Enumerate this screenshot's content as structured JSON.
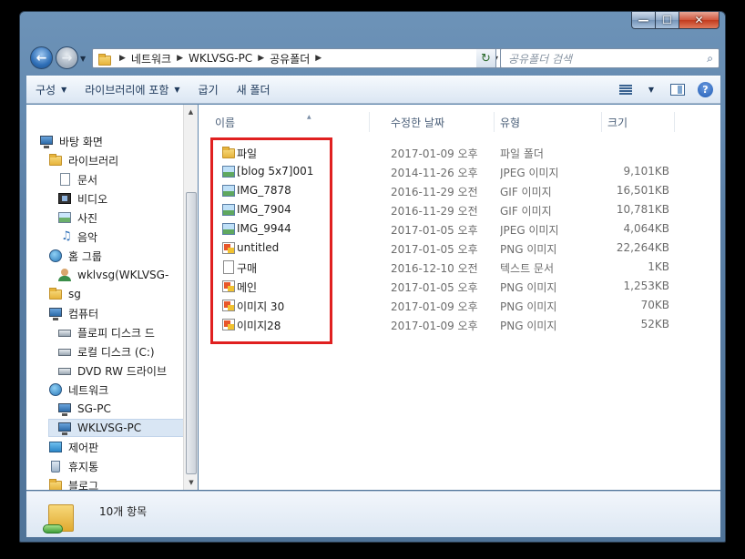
{
  "window": {
    "caption_buttons": {
      "minimize": "—",
      "maximize": "☐",
      "close": "✕"
    }
  },
  "address": {
    "crumbs": [
      "네트워크",
      "WKLVSG-PC",
      "공유폴더"
    ],
    "search_placeholder": "공유폴더 검색"
  },
  "toolbar": {
    "organize": "구성",
    "include_library": "라이브러리에 포함",
    "share": "굽기",
    "new_folder": "새 폴더",
    "help": "?"
  },
  "nav": {
    "items": [
      {
        "label": "바탕 화면",
        "icon": "desktop-icon"
      },
      {
        "label": "라이브러리",
        "icon": "library-folder-icon"
      },
      {
        "label": "문서",
        "icon": "documents-icon"
      },
      {
        "label": "비디오",
        "icon": "videos-icon"
      },
      {
        "label": "사진",
        "icon": "pictures-icon"
      },
      {
        "label": "음악",
        "icon": "music-icon"
      },
      {
        "label": "홈 그룹",
        "icon": "homegroup-icon"
      },
      {
        "label": "wklvsg(WKLVSG-",
        "icon": "user-icon"
      },
      {
        "label": "sg",
        "icon": "folder-icon"
      },
      {
        "label": "컴퓨터",
        "icon": "computer-icon"
      },
      {
        "label": "플로피 디스크 드",
        "icon": "floppy-drive-icon"
      },
      {
        "label": "로컬 디스크 (C:)",
        "icon": "local-disk-icon"
      },
      {
        "label": "DVD RW 드라이브",
        "icon": "dvd-drive-icon"
      },
      {
        "label": "네트워크",
        "icon": "network-icon"
      },
      {
        "label": "SG-PC",
        "icon": "network-computer-icon"
      },
      {
        "label": "WKLVSG-PC",
        "icon": "network-computer-icon"
      },
      {
        "label": "제어판",
        "icon": "control-panel-icon"
      },
      {
        "label": "휴지통",
        "icon": "recycle-bin-icon"
      },
      {
        "label": "블로그",
        "icon": "folder-icon"
      }
    ],
    "selected_label": "WKLVSG-PC"
  },
  "columns": {
    "name": "이름",
    "date": "수정한 날짜",
    "type": "유형",
    "size": "크기"
  },
  "files": [
    {
      "name": "파일",
      "date": "2017-01-09 오후...",
      "type": "파일 폴더",
      "size": "",
      "icon": "folder-icon"
    },
    {
      "name": "[blog 5x7]001",
      "date": "2014-11-26 오후...",
      "type": "JPEG 이미지",
      "size": "9,101KB",
      "icon": "jpeg-image-icon"
    },
    {
      "name": "IMG_7878",
      "date": "2016-11-29 오전...",
      "type": "GIF 이미지",
      "size": "16,501KB",
      "icon": "gif-image-icon"
    },
    {
      "name": "IMG_7904",
      "date": "2016-11-29 오전...",
      "type": "GIF 이미지",
      "size": "10,781KB",
      "icon": "gif-image-icon"
    },
    {
      "name": "IMG_9944",
      "date": "2017-01-05 오후...",
      "type": "JPEG 이미지",
      "size": "4,064KB",
      "icon": "jpeg-image-icon"
    },
    {
      "name": "untitled",
      "date": "2017-01-05 오후...",
      "type": "PNG 이미지",
      "size": "22,264KB",
      "icon": "png-image-icon"
    },
    {
      "name": "구매",
      "date": "2016-12-10 오전...",
      "type": "텍스트 문서",
      "size": "1KB",
      "icon": "text-file-icon"
    },
    {
      "name": "메인",
      "date": "2017-01-05 오후...",
      "type": "PNG 이미지",
      "size": "1,253KB",
      "icon": "png-image-icon"
    },
    {
      "name": "이미지 30",
      "date": "2017-01-09 오후...",
      "type": "PNG 이미지",
      "size": "70KB",
      "icon": "png-image-icon"
    },
    {
      "name": "이미지28",
      "date": "2017-01-09 오후...",
      "type": "PNG 이미지",
      "size": "52KB",
      "icon": "png-image-icon"
    }
  ],
  "details": {
    "item_count": "10개 항목"
  },
  "colors": {
    "highlight_box": "#e02020",
    "window_frame": "#5a7fa6"
  }
}
